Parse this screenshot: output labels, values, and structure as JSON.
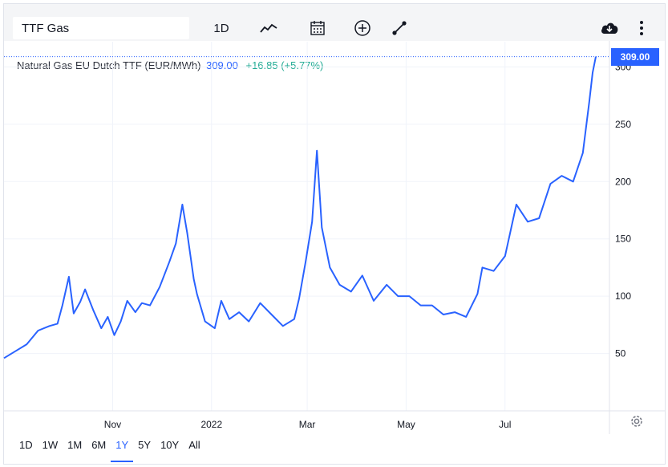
{
  "toolbar": {
    "symbol_value": "TTF Gas",
    "interval_label": "1D",
    "icons": [
      "line-chart-icon",
      "calendar-icon",
      "add-circle-icon",
      "compare-icon",
      "cloud-download-icon",
      "more-vert-icon"
    ]
  },
  "legend": {
    "name": "Natural Gas EU Dutch TTF (EUR/MWh)",
    "price": "309.00",
    "change": "+16.85 (+5.77%)"
  },
  "price_badge": "309.00",
  "ranges": [
    {
      "label": "1D",
      "active": false
    },
    {
      "label": "1W",
      "active": false
    },
    {
      "label": "1M",
      "active": false
    },
    {
      "label": "6M",
      "active": false
    },
    {
      "label": "1Y",
      "active": true
    },
    {
      "label": "5Y",
      "active": false
    },
    {
      "label": "10Y",
      "active": false
    },
    {
      "label": "All",
      "active": false
    }
  ],
  "colors": {
    "line": "#2962ff",
    "grid": "#f0f3fa",
    "up": "#22ab94"
  },
  "chart_data": {
    "type": "line",
    "x_ticks": [
      "Nov",
      "2022",
      "Mar",
      "May",
      "Jul"
    ],
    "y_ticks": [
      "50",
      "100",
      "150",
      "200",
      "250",
      "300"
    ],
    "ylim": [
      0,
      322
    ],
    "grid": true,
    "series": [
      {
        "x": [
          "2021-08-26",
          "2021-09-02",
          "2021-09-09",
          "2021-09-16",
          "2021-09-23",
          "2021-09-28",
          "2021-10-01",
          "2021-10-05",
          "2021-10-08",
          "2021-10-12",
          "2021-10-15",
          "2021-10-20",
          "2021-10-25",
          "2021-10-29",
          "2021-11-02",
          "2021-11-06",
          "2021-11-10",
          "2021-11-15",
          "2021-11-19",
          "2021-11-24",
          "2021-11-30",
          "2021-12-06",
          "2021-12-10",
          "2021-12-14",
          "2021-12-17",
          "2021-12-21",
          "2021-12-23",
          "2021-12-28",
          "2022-01-03",
          "2022-01-07",
          "2022-01-12",
          "2022-01-18",
          "2022-01-24",
          "2022-01-31",
          "2022-02-07",
          "2022-02-14",
          "2022-02-21",
          "2022-02-24",
          "2022-02-28",
          "2022-03-04",
          "2022-03-07",
          "2022-03-10",
          "2022-03-15",
          "2022-03-21",
          "2022-03-28",
          "2022-04-04",
          "2022-04-11",
          "2022-04-19",
          "2022-04-26",
          "2022-05-03",
          "2022-05-10",
          "2022-05-17",
          "2022-05-24",
          "2022-05-31",
          "2022-06-07",
          "2022-06-14",
          "2022-06-17",
          "2022-06-24",
          "2022-07-01",
          "2022-07-08",
          "2022-07-15",
          "2022-07-22",
          "2022-07-29",
          "2022-08-05",
          "2022-08-12",
          "2022-08-18",
          "2022-08-22",
          "2022-08-24",
          "2022-08-26"
        ],
        "y": [
          46,
          52,
          58,
          70,
          74,
          76,
          92,
          117,
          85,
          95,
          106,
          88,
          72,
          82,
          66,
          78,
          96,
          86,
          94,
          92,
          108,
          130,
          146,
          180,
          155,
          115,
          102,
          78,
          72,
          96,
          80,
          86,
          78,
          94,
          84,
          74,
          80,
          98,
          130,
          165,
          227,
          160,
          125,
          110,
          104,
          118,
          96,
          110,
          100,
          100,
          92,
          92,
          84,
          86,
          82,
          102,
          125,
          122,
          135,
          180,
          165,
          168,
          198,
          205,
          200,
          225,
          270,
          295,
          309
        ]
      }
    ]
  }
}
